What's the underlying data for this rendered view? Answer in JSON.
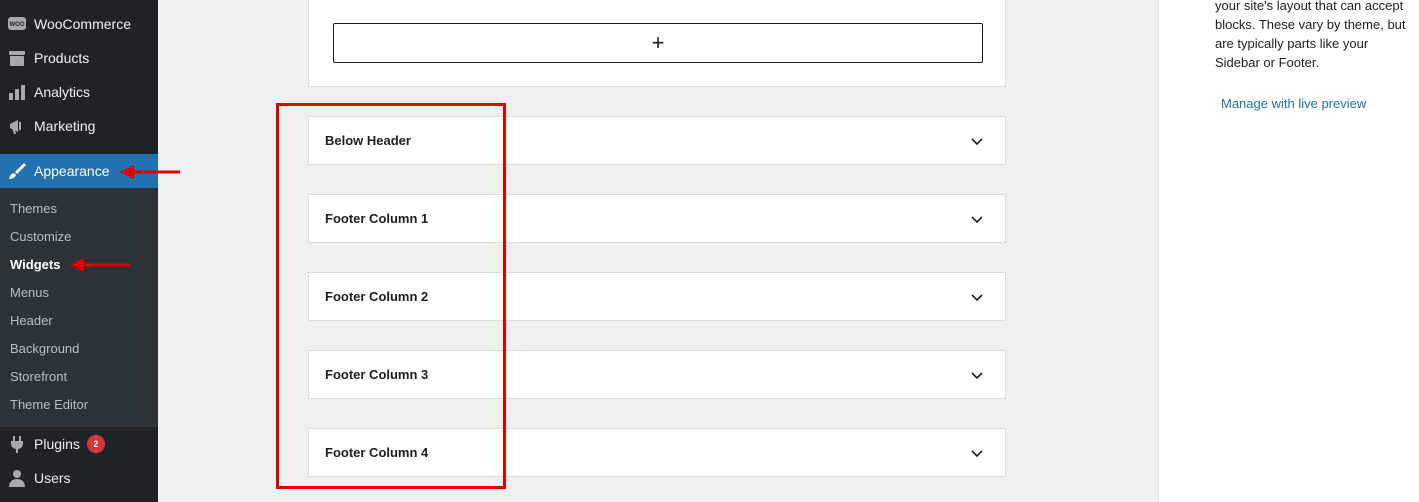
{
  "sidebar": {
    "woocommerce": "WooCommerce",
    "products": "Products",
    "analytics": "Analytics",
    "marketing": "Marketing",
    "appearance": "Appearance",
    "submenu": [
      "Themes",
      "Customize",
      "Widgets",
      "Menus",
      "Header",
      "Background",
      "Storefront",
      "Theme Editor"
    ],
    "plugins": "Plugins",
    "plugins_badge": "2",
    "users": "Users",
    "woo_icon_text": "WOO"
  },
  "editor": {
    "add_block_symbol": "+",
    "widget_areas": [
      "Below Header",
      "Footer Column 1",
      "Footer Column 2",
      "Footer Column 3",
      "Footer Column 4"
    ]
  },
  "right_panel": {
    "description_lines": [
      "your site's layout that can accept",
      "blocks. These vary by theme, but",
      "are typically parts like your",
      "Sidebar or Footer."
    ],
    "live_preview_link": "Manage with live preview"
  },
  "colors": {
    "sidebar_bg": "#1d2327",
    "submenu_bg": "#2c3338",
    "accent": "#2271b1",
    "badge": "#d63638",
    "annotation": "#e00000"
  }
}
